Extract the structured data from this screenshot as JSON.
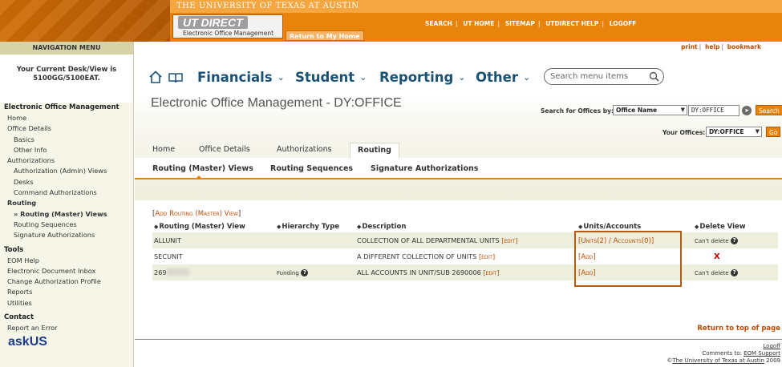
{
  "banner": {
    "university": "THE UNIVERSITY OF TEXAS AT AUSTIN",
    "logo": "UT DIRECT",
    "logo_sub": "Electronic Office Management",
    "return_home": "Return to My Home",
    "links": [
      "SEARCH",
      "UT HOME",
      "SITEMAP",
      "UTDIRECT HELP",
      "LOGOFF"
    ],
    "accent_color": "#e8830c"
  },
  "sidebar": {
    "title": "NAVIGATION MENU",
    "desk_line1": "Your Current Desk/View is",
    "desk_line2": "5100GG/5100EAT.",
    "section_eom": "Electronic Office Management",
    "items": {
      "home": "Home",
      "office_details": "Office Details",
      "basics": "Basics",
      "other_info": "Other Info",
      "authorizations": "Authorizations",
      "auth_admin_views": "Authorization (Admin) Views",
      "desks": "Desks",
      "command_auth": "Command Authorizations",
      "routing": "Routing",
      "routing_master": "» Routing (Master) Views",
      "routing_sequences": "Routing Sequences",
      "signature_auth": "Signature Authorizations"
    },
    "tools_head": "Tools",
    "tools": [
      "EOM Help",
      "Electronic Document Inbox",
      "Change Authorization Profile",
      "Reports",
      "Utilities"
    ],
    "contact_head": "Contact",
    "contact": [
      "Report an Error"
    ],
    "ask_logo": "askUS"
  },
  "util_links": [
    "print",
    "help",
    "bookmark"
  ],
  "megamenu": {
    "home_icon": "house-icon",
    "book_icon": "book-icon",
    "items": [
      "Financials",
      "Student",
      "Reporting",
      "Other"
    ],
    "search_placeholder": "Search menu items"
  },
  "header": {
    "title": "Electronic Office Management - DY:OFFICE",
    "search_offices_label": "Search for Offices by:",
    "search_by_value": "Office Name",
    "search_text": "DY:OFFICE",
    "search_button": "Search",
    "your_offices_label": "Your Offices:",
    "your_offices_value": "DY:OFFICE",
    "go_button": "Go"
  },
  "tabs": [
    "Home",
    "Office Details",
    "Authorizations",
    "Routing"
  ],
  "active_tab": "Routing",
  "subtabs": [
    "Routing (Master) Views",
    "Routing Sequences",
    "Signature Authorizations"
  ],
  "add_link": "Add Routing (Master) View",
  "table": {
    "headers": [
      "Routing (Master) View",
      "Hierarchy Type",
      "Description",
      "Units/Accounts",
      "Delete View"
    ],
    "rows": [
      {
        "view": "ALLUNIT",
        "hierarchy": "",
        "description": "COLLECTION OF ALL DEPARTMENTAL UNITS",
        "edit": "edit",
        "units": "Units(2) / Accounts(0)",
        "delete": "Can't delete"
      },
      {
        "view": "SECUNIT",
        "hierarchy": "",
        "description": "A DIFFERENT COLLECTION OF UNITS",
        "edit": "edit",
        "units": "Add",
        "delete": "X"
      },
      {
        "view": "269",
        "hierarchy": "Funding",
        "description": "ALL ACCOUNTS IN UNIT/SUB 2690006",
        "edit": "edit",
        "units": "Add",
        "delete": "Can't delete"
      }
    ]
  },
  "return_top": "Return to top of page",
  "footer": {
    "logoff": "Logoff",
    "comments": "Comments to:",
    "support": "EOM Support",
    "copyright_sym": "©",
    "university_link": "The University of Texas at Austin",
    "year": "2009"
  }
}
